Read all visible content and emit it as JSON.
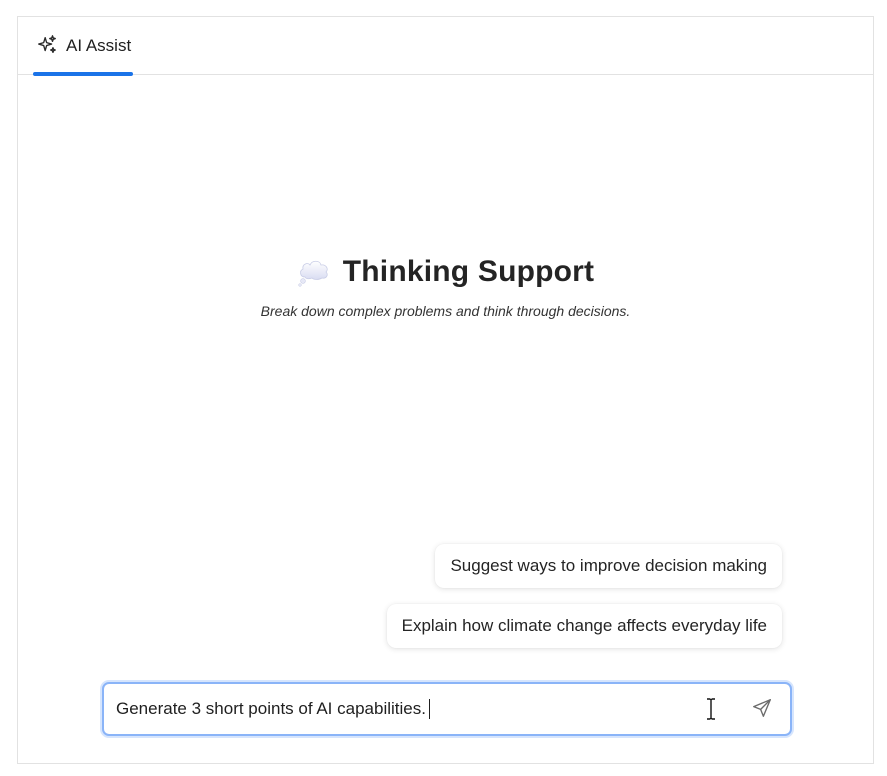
{
  "tab": {
    "label": "AI Assist",
    "icon": "sparkles-icon",
    "accent_color": "#1a73e8"
  },
  "hero": {
    "emoji_icon": "thought-balloon-icon",
    "title": "Thinking Support",
    "subtitle": "Break down complex problems and think through decisions."
  },
  "suggestions": [
    {
      "label": "Suggest ways to improve decision making"
    },
    {
      "label": "Explain how climate change affects everyday life"
    }
  ],
  "composer": {
    "value": "Generate 3 short points of AI capabilities.",
    "send_icon": "send-icon",
    "focus_color": "#8ab4f8"
  }
}
